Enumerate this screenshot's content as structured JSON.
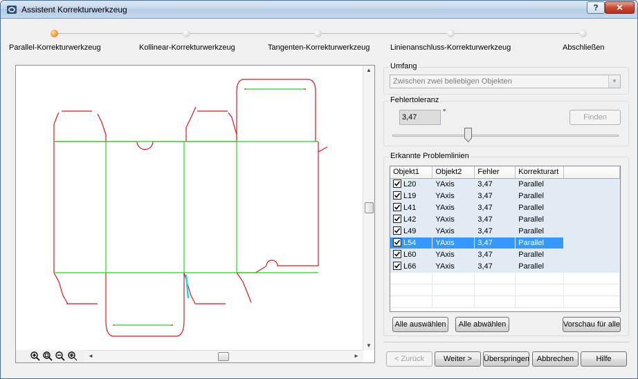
{
  "window": {
    "title": "Assistent Korrekturwerkzeug",
    "help_glyph": "?",
    "close_glyph": "✕"
  },
  "steps": [
    {
      "label": "Parallel-Korrekturwerkzeug",
      "active": true
    },
    {
      "label": "Kollinear-Korrekturwerkzeug",
      "active": false
    },
    {
      "label": "Tangenten-Korrekturwerkzeug",
      "active": false
    },
    {
      "label": "Linienanschluss-Korrekturwerkzeug",
      "active": false
    },
    {
      "label": "Abschließen",
      "active": false
    }
  ],
  "umfang": {
    "title": "Umfang",
    "value": "Zwischen zwei beliebigen Objekten"
  },
  "tolerance": {
    "title": "Fehlertoleranz",
    "value": "3,47",
    "unit": "°",
    "find_label": "Finden"
  },
  "problems": {
    "title": "Erkannte Problemlinien",
    "columns": [
      "Objekt1",
      "Objekt2",
      "Fehler",
      "Korrekturart"
    ],
    "rows": [
      {
        "obj1": "L20",
        "obj2": "YAxis",
        "error": "3,47",
        "type": "Parallel",
        "checked": true,
        "selected": false
      },
      {
        "obj1": "L19",
        "obj2": "YAxis",
        "error": "3,47",
        "type": "Parallel",
        "checked": true,
        "selected": false
      },
      {
        "obj1": "L41",
        "obj2": "YAxis",
        "error": "3,47",
        "type": "Parallel",
        "checked": true,
        "selected": false
      },
      {
        "obj1": "L42",
        "obj2": "YAxis",
        "error": "3,47",
        "type": "Parallel",
        "checked": true,
        "selected": false
      },
      {
        "obj1": "L49",
        "obj2": "YAxis",
        "error": "3,47",
        "type": "Parallel",
        "checked": true,
        "selected": false
      },
      {
        "obj1": "L54",
        "obj2": "YAxis",
        "error": "3,47",
        "type": "Parallel",
        "checked": true,
        "selected": true
      },
      {
        "obj1": "L60",
        "obj2": "YAxis",
        "error": "3,47",
        "type": "Parallel",
        "checked": true,
        "selected": false
      },
      {
        "obj1": "L66",
        "obj2": "YAxis",
        "error": "3,47",
        "type": "Parallel",
        "checked": true,
        "selected": false
      }
    ],
    "select_all_label": "Alle auswählen",
    "deselect_all_label": "Alle abwählen",
    "preview_label": "Vorschau für alle"
  },
  "footer": {
    "back_label": "< Zurück",
    "next_label": "Weiter >",
    "skip_label": "Überspringen",
    "cancel_label": "Abbrechen",
    "help_label": "Hilfe"
  },
  "colors": {
    "cut_line": "#e0141e",
    "fold_line": "#1fd81f",
    "highlight_line": "#00e0ff",
    "selection": "#3399ff"
  },
  "icons": [
    "app-icon",
    "zoom-in-icon",
    "zoom-window-icon",
    "zoom-out-icon",
    "zoom-fit-icon"
  ]
}
